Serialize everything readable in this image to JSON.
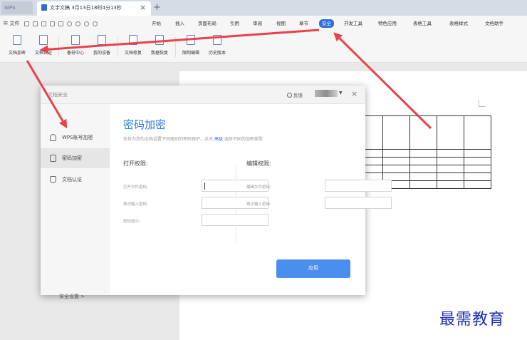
{
  "titlebar": {
    "app_tab": "WPS",
    "doc_tab": "文字文稿 3月13日18时4分13秒"
  },
  "menubar": {
    "file_menu": "文件",
    "items": [
      {
        "label": "开始"
      },
      {
        "label": "插入"
      },
      {
        "label": "页面布局"
      },
      {
        "label": "引用"
      },
      {
        "label": "审阅"
      },
      {
        "label": "视图"
      },
      {
        "label": "章节"
      },
      {
        "label": "安全",
        "active": true
      },
      {
        "label": "开发工具"
      },
      {
        "label": "特色应用"
      },
      {
        "label": "表格工具"
      },
      {
        "label": "表格样式"
      },
      {
        "label": "文档助手"
      }
    ]
  },
  "ribbon": {
    "buttons": [
      {
        "label": "文档加密"
      },
      {
        "label": "文档认证"
      },
      {
        "label": "备份中心"
      },
      {
        "label": "我的设备"
      },
      {
        "label": "文档修复"
      },
      {
        "label": "数据恢复"
      },
      {
        "label": "限制编辑"
      },
      {
        "label": "历史版本"
      }
    ]
  },
  "dialog": {
    "title": "文档安全",
    "feedback": "反馈",
    "close": "×",
    "sidebar": {
      "items": [
        {
          "label": "WPS账号加密"
        },
        {
          "label": "密码加密",
          "active": true
        },
        {
          "label": "文档认证"
        }
      ],
      "security_settings": "安全设置 >"
    },
    "main": {
      "title": "密码加密",
      "desc_before": "支持为您的文档设置不同级别的密码保护，点击",
      "desc_link": "高级",
      "desc_after": "选择不同的加密类型",
      "open_section": {
        "title": "打开权限:",
        "fields": [
          {
            "label": "打开文件密码:"
          },
          {
            "label": "再次输入密码:"
          },
          {
            "label": "密码提示:"
          }
        ]
      },
      "edit_section": {
        "title": "编辑权限:",
        "fields": [
          {
            "label": "编辑文件密码:"
          },
          {
            "label": "再次输入密码:"
          }
        ]
      },
      "apply": "应用"
    }
  },
  "watermark": "最需教育",
  "colors": {
    "accent": "#2f6fe0",
    "title_blue": "#2f7ee0",
    "apply_button": "#4a8ef0",
    "arrow": "#e8434b",
    "watermark": "#1c2fb8"
  }
}
